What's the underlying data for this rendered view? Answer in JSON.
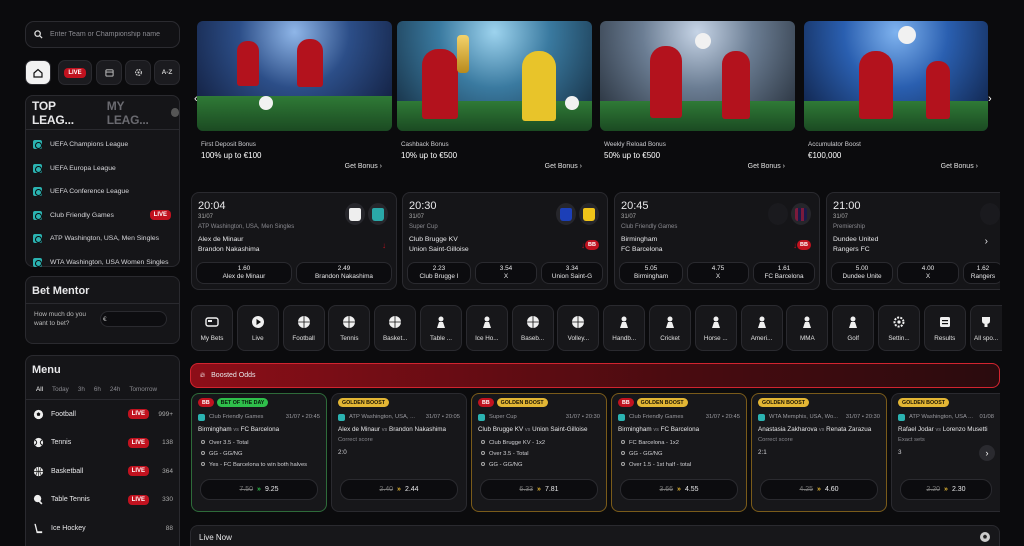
{
  "search": {
    "placeholder": "Enter Team or Championship name"
  },
  "nav": {
    "live": "LIVE",
    "az": "A-Z"
  },
  "leagues": {
    "tab_active": "TOP LEAG...",
    "tab_inactive": "MY LEAG...",
    "items": [
      {
        "label": "UEFA Champions League",
        "live": ""
      },
      {
        "label": "UEFA Europa League",
        "live": ""
      },
      {
        "label": "UEFA Conference League",
        "live": ""
      },
      {
        "label": "Club Friendly Games",
        "live": "LIVE"
      },
      {
        "label": "ATP Washington, USA, Men Singles",
        "live": ""
      },
      {
        "label": "WTA Washington, USA Women Singles",
        "live": ""
      }
    ]
  },
  "mentor": {
    "title": "Bet Mentor",
    "prompt": "How much do you want to bet?",
    "currency": "€"
  },
  "menu": {
    "title": "Menu",
    "filters": [
      "All",
      "Today",
      "3h",
      "6h",
      "24h",
      "Tomorrow"
    ],
    "sports": [
      {
        "name": "Football",
        "live": "LIVE",
        "count": "999+"
      },
      {
        "name": "Tennis",
        "live": "LIVE",
        "count": "138"
      },
      {
        "name": "Basketball",
        "live": "LIVE",
        "count": "364"
      },
      {
        "name": "Table Tennis",
        "live": "LIVE",
        "count": "330"
      },
      {
        "name": "Ice Hockey",
        "live": "",
        "count": "88"
      }
    ]
  },
  "promos": [
    {
      "title": "First Deposit Bonus",
      "offer": "100% up to €100",
      "cta": "Get Bonus"
    },
    {
      "title": "Cashback Bonus",
      "offer": "10% up to €500",
      "cta": "Get Bonus"
    },
    {
      "title": "Weekly Reload Bonus",
      "offer": "50% up to €500",
      "cta": "Get Bonus"
    },
    {
      "title": "Accumulator Boost",
      "offer": "€100,000",
      "cta": "Get Bonus"
    }
  ],
  "matches": [
    {
      "time": "20:04",
      "date": "31/07",
      "comp": "ATP Washington, USA, Men Singles",
      "home": "Alex de Minaur",
      "away": "Brandon Nakashima",
      "o1": "1.60",
      "o1l": "Alex de Minaur",
      "o2": "2.49",
      "o2l": "Brandon Nakashima",
      "bb": ""
    },
    {
      "time": "20:30",
      "date": "31/07",
      "comp": "Super Cup",
      "home": "Club Brugge KV",
      "away": "Union Saint-Gilloise",
      "o1": "2.23",
      "o1l": "Club Brugge I",
      "ox": "3.54",
      "oxl": "X",
      "o2": "3.34",
      "o2l": "Union Saint-G",
      "bb": "BB"
    },
    {
      "time": "20:45",
      "date": "31/07",
      "comp": "Club Friendly Games",
      "home": "Birmingham",
      "away": "FC Barcelona",
      "o1": "5.05",
      "o1l": "Birmingham",
      "ox": "4.75",
      "oxl": "X",
      "o2": "1.61",
      "o2l": "FC Barcelona",
      "bb": "BB"
    },
    {
      "time": "21:00",
      "date": "31/07",
      "comp": "Premiership",
      "home": "Dundee United",
      "away": "Rangers FC",
      "o1": "5.00",
      "o1l": "Dundee Unite",
      "ox": "4.00",
      "oxl": "X",
      "o2": "1.62",
      "o2l": "Rangers",
      "bb": ""
    }
  ],
  "sports_bar": [
    "My Bets",
    "Live",
    "Football",
    "Tennis",
    "Basket...",
    "Table ...",
    "Ice Ho...",
    "Baseb...",
    "Volley...",
    "Handb...",
    "Cricket",
    "Horse ...",
    "Ameri...",
    "MMA",
    "Golf",
    "Settin...",
    "Results",
    "All spo..."
  ],
  "boosted": {
    "title": "Boosted Odds"
  },
  "boosts": [
    {
      "tags": [
        "BB",
        "BET OF THE DAY"
      ],
      "comp": "Club Friendly Games",
      "dt": "31/07 • 20:45",
      "home": "Birmingham",
      "away": "FC Barcelona",
      "lines": [
        "Over 3.5 - Total",
        "GG - GG/NG",
        "Yes - FC Barcelona to win both halves"
      ],
      "old": "7.50",
      "new": "9.25",
      "style": "green"
    },
    {
      "tags": [
        "GOLDEN BOOST"
      ],
      "comp": "ATP Washington, USA, ...",
      "dt": "31/07 • 20:05",
      "home": "Alex de Minaur",
      "away": "Brandon Nakashima",
      "sub": "Correct score",
      "subv": "2:0",
      "old": "2.40",
      "new": "2.44",
      "style": "plain"
    },
    {
      "tags": [
        "BB",
        "GOLDEN BOOST"
      ],
      "comp": "Super Cup",
      "dt": "31/07 • 20:30",
      "home": "Club Brugge KV",
      "away": "Union Saint-Gilloise",
      "lines": [
        "Club Brugge KV - 1x2",
        "Over 3.5 - Total",
        "GG - GG/NG"
      ],
      "old": "6.33",
      "new": "7.81",
      "style": "gold"
    },
    {
      "tags": [
        "BB",
        "GOLDEN BOOST"
      ],
      "comp": "Club Friendly Games",
      "dt": "31/07 • 20:45",
      "home": "Birmingham",
      "away": "FC Barcelona",
      "lines": [
        "FC Barcelona - 1x2",
        "GG - GG/NG",
        "Over 1.5 - 1st half - total"
      ],
      "old": "3.66",
      "new": "4.55",
      "style": "gold"
    },
    {
      "tags": [
        "GOLDEN BOOST"
      ],
      "comp": "WTA Memphis, USA, Wo...",
      "dt": "31/07 • 20:30",
      "home": "Anastasia Zakharova",
      "away": "Renata Zarazua",
      "sub": "Correct score",
      "subv": "2:1",
      "old": "4.25",
      "new": "4.60",
      "style": "gold"
    },
    {
      "tags": [
        "GOLDEN BOOST"
      ],
      "comp": "ATP Washington, USA ...",
      "dt": "01/08",
      "home": "Rafael Jodar",
      "away": "Lorenzo Musetti",
      "sub": "Exact sets",
      "subv": "3",
      "old": "2.20",
      "new": "2.30",
      "style": "plain"
    }
  ],
  "livenow": {
    "title": "Live Now"
  },
  "colors": {
    "accent": "#c1121f",
    "gold": "#e3b634",
    "teal": "#2bb3b1",
    "green": "#2fbf4b"
  }
}
